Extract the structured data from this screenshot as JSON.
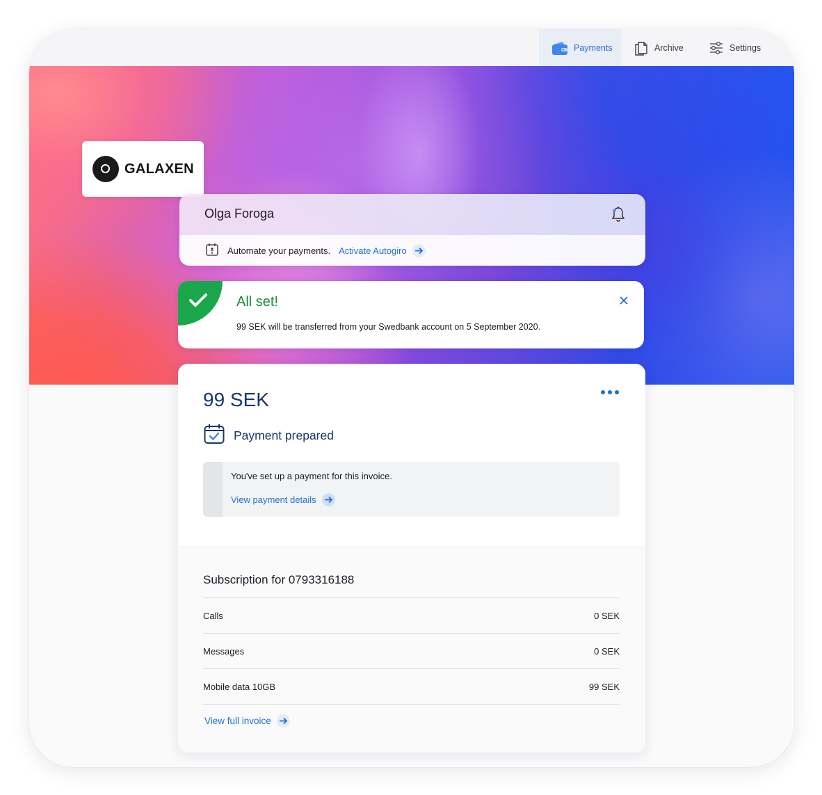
{
  "nav": {
    "items": [
      {
        "label": "Payments",
        "icon": "wallet-icon",
        "active": true
      },
      {
        "label": "Archive",
        "icon": "documents-icon",
        "active": false
      },
      {
        "label": "Settings",
        "icon": "sliders-icon",
        "active": false
      }
    ]
  },
  "brand": {
    "name": "GALAXEN"
  },
  "user": {
    "name": "Olga Foroga",
    "autogiro_text": "Automate your payments.",
    "autogiro_link": "Activate Autogiro"
  },
  "notice": {
    "title": "All set!",
    "message": "99 SEK will be transferred from your Swedbank account on 5 September 2020."
  },
  "payment": {
    "amount": "99 SEK",
    "status": "Payment prepared",
    "info_text": "You've set up a payment for this invoice.",
    "details_link": "View payment details"
  },
  "subscription": {
    "title": "Subscription for 0793316188",
    "rows": [
      {
        "label": "Calls",
        "value": "0 SEK"
      },
      {
        "label": "Messages",
        "value": "0 SEK"
      },
      {
        "label": "Mobile data 10GB",
        "value": "99 SEK"
      }
    ],
    "invoice_link": "View full invoice"
  },
  "colors": {
    "accent": "#1f6fd1",
    "success": "#1aa64b",
    "heading": "#17366e"
  }
}
